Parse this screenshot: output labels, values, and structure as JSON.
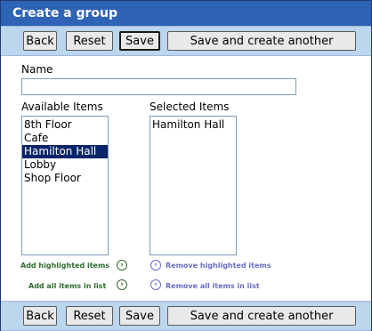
{
  "title": "Create a group",
  "toolbar": {
    "back": "Back",
    "reset": "Reset",
    "save": "Save",
    "save_another": "Save and create another"
  },
  "form": {
    "name_label": "Name",
    "name_value": "",
    "available_label": "Available Items",
    "selected_label": "Selected Items",
    "available_items": [
      "8th Floor",
      "Cafe",
      "Hamilton Hall",
      "Lobby",
      "Shop Floor"
    ],
    "available_highlighted": "Hamilton Hall",
    "selected_items": [
      "Hamilton Hall"
    ]
  },
  "actions": {
    "add_highlighted": "Add highlighted items",
    "remove_highlighted": "Remove highlighted items",
    "add_all": "Add all items in list",
    "remove_all": "Remove all items in list",
    "add_icon": "arrow-right-circle-icon",
    "remove_icon": "arrow-left-circle-icon"
  },
  "colors": {
    "title_bar": "#2f63b5",
    "toolbar": "#bcd6ee",
    "selection": "#0a246a",
    "add_action": "#2e6b2e",
    "remove_action": "#6b6bc6"
  }
}
